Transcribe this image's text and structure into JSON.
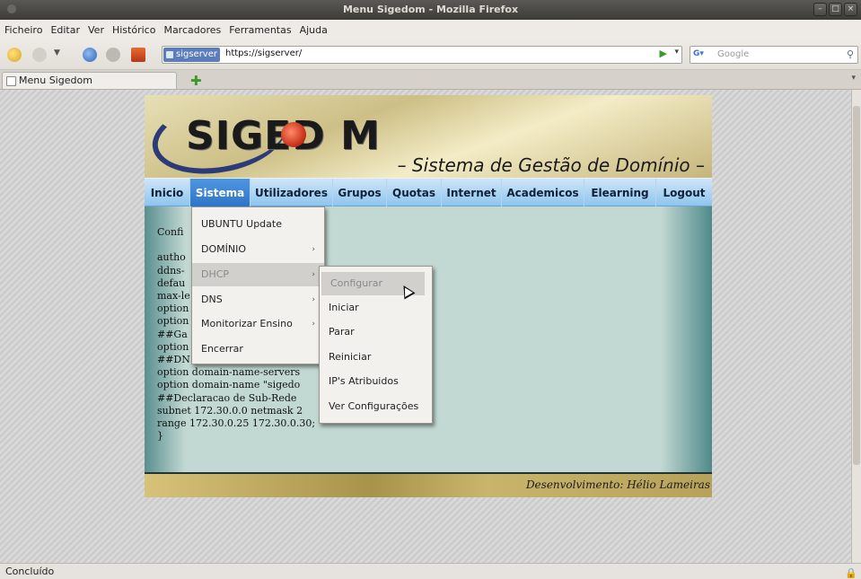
{
  "window": {
    "title": "Menu Sigedom - Mozilla Firefox"
  },
  "menubar": [
    "Ficheiro",
    "Editar",
    "Ver",
    "Histórico",
    "Marcadores",
    "Ferramentas",
    "Ajuda"
  ],
  "toolbar": {
    "site_identity": "sigserver",
    "url": "https://sigserver/",
    "search_placeholder": "Google"
  },
  "tabs": [
    {
      "label": "Menu Sigedom"
    }
  ],
  "banner": {
    "logo": "SIGED M",
    "subtitle": "– Sistema de Gestão de Domínio –"
  },
  "site_nav": [
    "Inicio",
    "Sistema",
    "Utilizadores",
    "Grupos",
    "Quotas",
    "Internet",
    "Academicos",
    "Elearning",
    "Logout"
  ],
  "site_nav_active": "Sistema",
  "config_text": "Confi\n\nautho\nddns-\ndefau\nmax-le\noption\noption\n##Ga\noption\n##DN\noption domain-name-servers\noption domain-name \"sigedo\n##Declaracao de Sub-Rede\nsubnet 172.30.0.0 netmask 2\nrange 172.30.0.25 172.30.0.30;\n}",
  "sistema_menu": [
    {
      "label": "UBUNTU Update",
      "submenu": false
    },
    {
      "label": "DOMÍNIO",
      "submenu": true
    },
    {
      "label": "DHCP",
      "submenu": true,
      "highlighted": true
    },
    {
      "label": "DNS",
      "submenu": true
    },
    {
      "label": "Monitorizar Ensino",
      "submenu": true
    },
    {
      "label": "Encerrar",
      "submenu": false
    }
  ],
  "dhcp_menu": [
    {
      "label": "Configurar",
      "highlighted": true
    },
    {
      "label": "Iniciar"
    },
    {
      "label": "Parar"
    },
    {
      "label": "Reiniciar"
    },
    {
      "label": "IP's Atribuidos"
    },
    {
      "label": "Ver Configurações"
    }
  ],
  "footer": "Desenvolvimento: Hélio Lameiras",
  "status": "Concluído",
  "colors": {
    "nav_active": "#2d73c6",
    "nav_bg": "#8ec5ee",
    "panel_bg": "#c2d8d3"
  }
}
